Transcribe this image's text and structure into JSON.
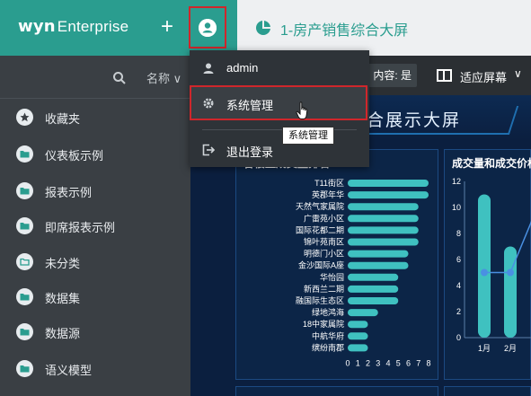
{
  "brand": {
    "logo_main": "wyn",
    "logo_sub": "Enterprise",
    "color": "#2a9d8f"
  },
  "header": {
    "add_label": "+",
    "tab_title": "1-房产销售综合大屏"
  },
  "sidebar": {
    "sort_label": "名称 ∨",
    "items": [
      {
        "label": "收藏夹",
        "icon": "star-icon"
      },
      {
        "label": "仪表板示例",
        "icon": "folder-icon"
      },
      {
        "label": "报表示例",
        "icon": "folder-icon"
      },
      {
        "label": "即席报表示例",
        "icon": "folder-icon"
      },
      {
        "label": "未分类",
        "icon": "folder-outline-icon"
      },
      {
        "label": "数据集",
        "icon": "folder-icon"
      },
      {
        "label": "数据源",
        "icon": "folder-icon"
      },
      {
        "label": "语义模型",
        "icon": "folder-icon"
      }
    ]
  },
  "toolbar": {
    "content_label": "内容: 是",
    "fit_label": "适应屏幕",
    "fit_caret": "∨"
  },
  "dashboard": {
    "title": "合展示大屏",
    "panel1_title": "各楼盘成交量排名",
    "panel2_title": "成交量和成交价格"
  },
  "user_menu": {
    "items": [
      {
        "label": "admin",
        "icon": "user-icon"
      },
      {
        "label": "系统管理",
        "icon": "gear-icon"
      },
      {
        "label": "退出登录",
        "icon": "logout-icon"
      }
    ],
    "tooltip": "系统管理"
  },
  "chart_data": [
    {
      "type": "bar",
      "orientation": "horizontal",
      "title": "各楼盘成交量排名",
      "categories": [
        "T11街区",
        "英郡年华",
        "天然气家属院",
        "广雷苑小区",
        "国际花都二期",
        "锦叶苑南区",
        "明德门小区",
        "金沙国际A座",
        "华怡园",
        "新西兰二期",
        "融国际生态区",
        "绿地鸿海",
        "18中家属院",
        "中航华府",
        "缤纷南郡"
      ],
      "values": [
        8,
        8,
        7,
        7,
        7,
        7,
        6,
        6,
        5,
        5,
        5,
        3,
        2,
        2,
        2
      ],
      "xlim": [
        0,
        8
      ],
      "xticks": [
        "0",
        "1",
        "2",
        "3",
        "4",
        "5",
        "6",
        "7",
        "8"
      ],
      "bar_color": "#3fc1c0"
    },
    {
      "type": "line",
      "title": "成交量和成交价格",
      "categories": [
        "1月",
        "2月"
      ],
      "series": [
        {
          "type": "range-bar",
          "values": [
            [
              0,
              11
            ],
            [
              0,
              7
            ]
          ]
        },
        {
          "type": "line",
          "values": [
            5,
            5
          ]
        }
      ],
      "ylim": [
        0,
        12
      ],
      "yticks": [
        "0",
        "2",
        "4",
        "6",
        "8",
        "10",
        "12"
      ],
      "bar_color": "#3fc1c0",
      "line_color": "#4a90e2"
    }
  ]
}
